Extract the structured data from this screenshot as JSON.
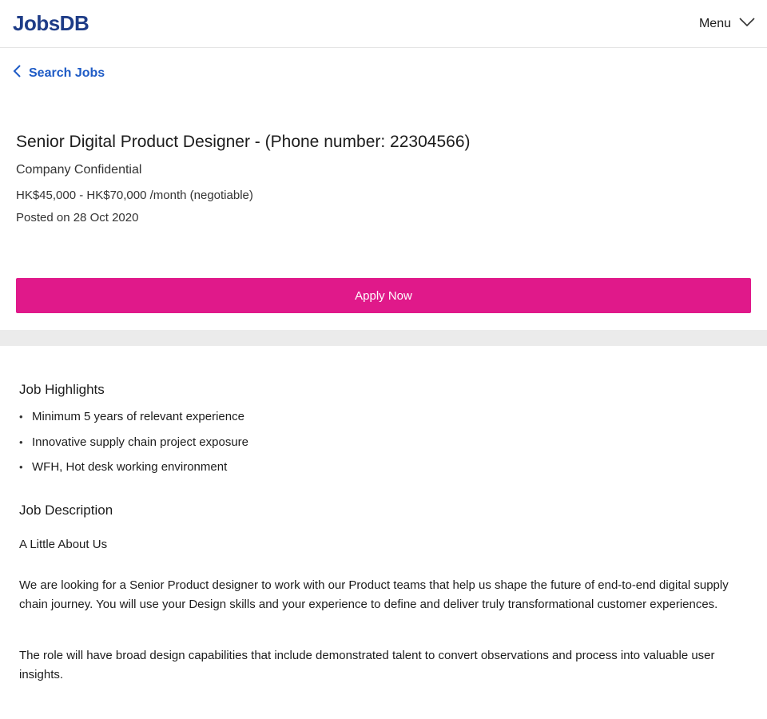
{
  "header": {
    "logo": "JobsDB",
    "menu_label": "Menu",
    "menu_icon": "chevron-down-icon"
  },
  "nav": {
    "back_label": "Search Jobs",
    "back_icon": "chevron-left-icon"
  },
  "job": {
    "title": "Senior Digital Product Designer - (Phone number: 22304566)",
    "company": "Company Confidential",
    "salary": "HK$45,000 - HK$70,000 /month (negotiable)",
    "posted": "Posted on 28 Oct 2020"
  },
  "apply": {
    "label": "Apply Now"
  },
  "highlights": {
    "title": "Job Highlights",
    "items": [
      "Minimum 5 years of relevant experience",
      "Innovative supply chain project exposure",
      "WFH, Hot desk working environment"
    ]
  },
  "description": {
    "title": "Job Description",
    "subtitle": "A Little About Us",
    "paragraphs": [
      "We are looking for a Senior Product designer to work with our Product teams that help us shape the future of end-to-end digital supply chain journey. You will use your Design skills and your experience to define and deliver truly transformational customer experiences.",
      "The role will have broad design capabilities that include demonstrated talent to convert observations and process into valuable user insights."
    ]
  },
  "colors": {
    "brand": "#1e3c87",
    "link": "#1e5bc6",
    "apply": "#e0198a"
  }
}
